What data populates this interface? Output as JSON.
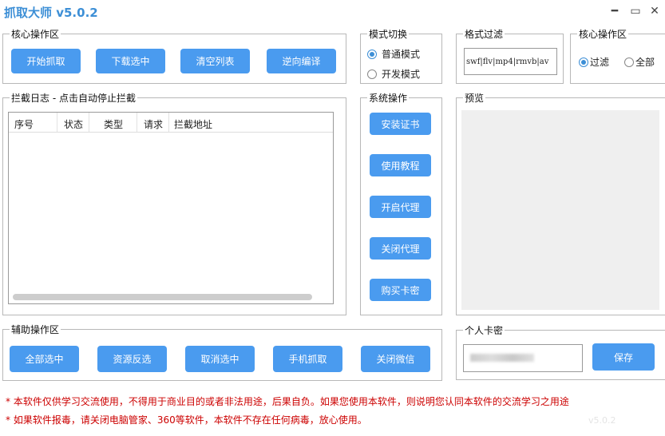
{
  "window": {
    "title": "抓取大师 v5.0.2",
    "minimize": "━",
    "maximize": "▭",
    "close": "✕"
  },
  "core": {
    "legend": "核心操作区",
    "buttons": [
      "开始抓取",
      "下载选中",
      "清空列表",
      "逆向编译"
    ]
  },
  "log": {
    "legend": "拦截日志 - 点击自动停止拦截",
    "columns": [
      "序号",
      "状态",
      "类型",
      "请求",
      "拦截地址"
    ]
  },
  "mode": {
    "legend": "模式切换",
    "options": [
      {
        "label": "普通模式",
        "checked": true
      },
      {
        "label": "开发模式",
        "checked": false
      }
    ]
  },
  "system": {
    "legend": "系统操作",
    "buttons": [
      "安装证书",
      "使用教程",
      "开启代理",
      "关闭代理",
      "购买卡密"
    ]
  },
  "filter": {
    "legend": "格式过滤",
    "value": "swf|flv|mp4|rmvb|av"
  },
  "core2": {
    "legend": "核心操作区",
    "options": [
      {
        "label": "过滤",
        "checked": true
      },
      {
        "label": "全部",
        "checked": false
      }
    ]
  },
  "preview": {
    "legend": "预览"
  },
  "aux": {
    "legend": "辅助操作区",
    "buttons": [
      "全部选中",
      "资源反选",
      "取消选中",
      "手机抓取",
      "关闭微信"
    ]
  },
  "card": {
    "legend": "个人卡密",
    "save": "保存"
  },
  "notes": [
    "* 本软件仅供学习交流使用，不得用于商业目的或者非法用途，后果自负。如果您使用本软件，则说明您认同本软件的交流学习之用途",
    "* 如果软件报毒，请关闭电脑管家、360等软件，本软件不存在任何病毒，放心使用。"
  ],
  "version": "v5.0.2"
}
